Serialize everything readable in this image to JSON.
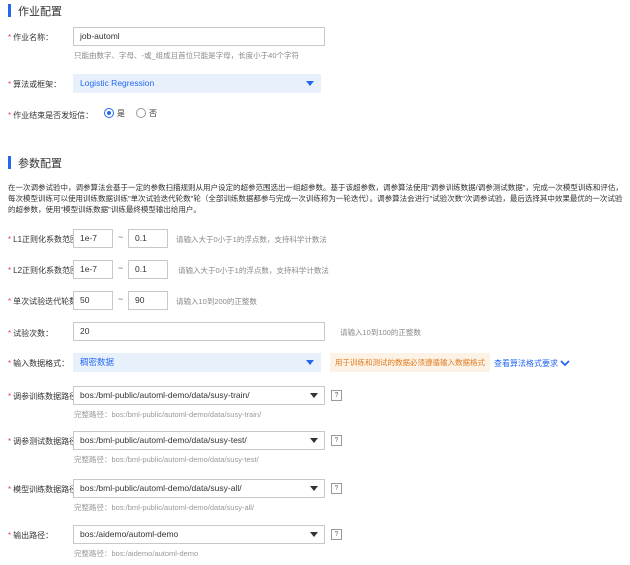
{
  "job_config": {
    "title": "作业配置",
    "job_name_label": "作业名称：",
    "job_name_value": "job-automl",
    "job_name_hint": "只能由数字、字母、-或_组成且首位只能是字母，长度小于40个字符",
    "algo_label": "算法或框架：",
    "algo_value": "Logistic Regression",
    "sms_label": "作业结束是否发短信：",
    "sms_yes": "是",
    "sms_no": "否"
  },
  "params": {
    "title": "参数配置",
    "description": "在一次调参试验中，调参算法会基于一定的参数扫描规则从用户设定的超参范围选出一组超参数。基于该超参数，调参算法使用\"调参训练数据/调参测试数据\"，完成一次模型训练和评估，每次模型训练可以使用训练数据训练\"单次试验迭代轮数\"轮（全部训练数据都参与完成一次训练称为一轮迭代）。调参算法会进行\"试验次数\"次调参试验，最后选择其中效果最优的一次试验的超参数，使用\"模型训练数据\"训练最终模型输出给用户。",
    "l1_label": "L1正则化系数范围：",
    "l1_min": "1e-7",
    "l1_max": "0.1",
    "l1_hint": "请输入大于0小于1的浮点数，支持科学计数法",
    "l2_label": "L2正则化系数范围：",
    "l2_min": "1e-7",
    "l2_max": "0.1",
    "l2_hint": "请输入大于0小于1的浮点数，支持科学计数法",
    "epoch_label": "单次试验迭代轮数：",
    "epoch_min": "50",
    "epoch_max": "90",
    "epoch_hint": "请输入10到200的正整数",
    "trials_label": "试验次数：",
    "trials_value": "20",
    "trials_hint": "请输入10到100的正整数",
    "input_format_label": "输入数据格式：",
    "input_format_value": "稠密数据",
    "input_format_warn": "用于训练和测试的数据必须遵循输入数据格式",
    "format_link": "查看算法格式要求",
    "tilde": "~",
    "q_mark": "?",
    "train_label": "调参训练数据路径：",
    "train_value": "bos:/bml-public/automl-demo/data/susy-train/",
    "train_full": "完整路径：bos:/bml-public/automl-demo/data/susy-train/",
    "test_label": "调参测试数据路径：",
    "test_value": "bos:/bml-public/automl-demo/data/susy-test/",
    "test_full": "完整路径：bos:/bml-public/automl-demo/data/susy-test/",
    "model_label": "模型训练数据路径：",
    "model_value": "bos:/bml-public/automl-demo/data/susy-all/",
    "model_full": "完整路径：bos:/bml-public/automl-demo/data/susy-all/",
    "output_label": "输出路径：",
    "output_value": "bos:/aidemo/automl-demo",
    "output_full": "完整路径：bos:/aidemo/automl-demo"
  },
  "required_mark": "*",
  "colors": {
    "accent": "#2468f2",
    "warn": "#e07a1f",
    "required": "#e64552"
  }
}
